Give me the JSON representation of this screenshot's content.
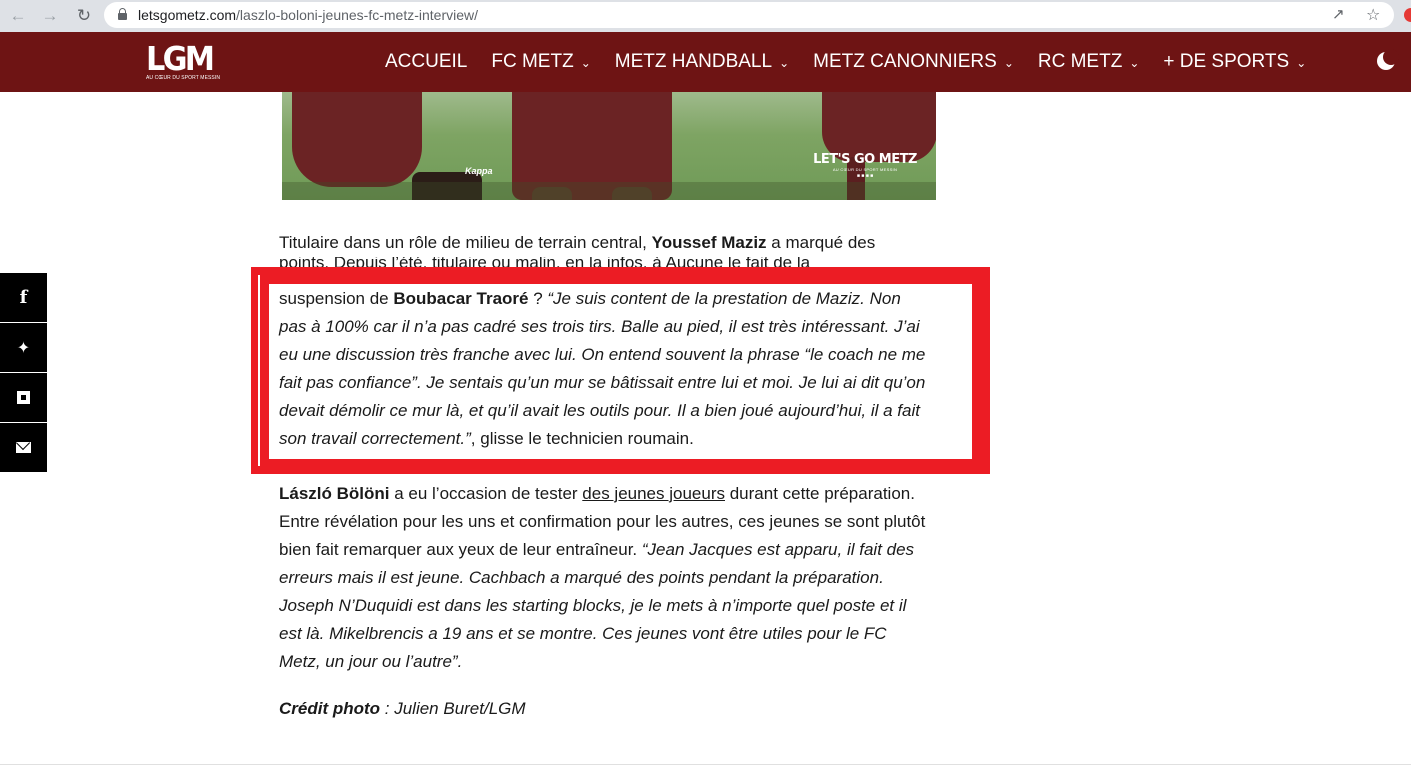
{
  "browser": {
    "url_host": "letsgometz.com",
    "url_path": "/laszlo-boloni-jeunes-fc-metz-interview/"
  },
  "site": {
    "logo": "LGM",
    "logo_tagline": "AU CŒUR DU SPORT MESSIN",
    "nav": [
      {
        "label": "ACCUEIL",
        "dropdown": false
      },
      {
        "label": "FC METZ",
        "dropdown": true
      },
      {
        "label": "METZ HANDBALL",
        "dropdown": true
      },
      {
        "label": "METZ CANONNIERS",
        "dropdown": true
      },
      {
        "label": "RC METZ",
        "dropdown": true
      },
      {
        "label": "+ DE SPORTS",
        "dropdown": true
      }
    ]
  },
  "hero": {
    "kit_brand": "Kappa",
    "watermark_title": "LET'S GO METZ",
    "watermark_sub": "AU CŒUR DU SPORT MESSIN"
  },
  "share": [
    "facebook-icon",
    "twitter-icon",
    "flipboard-icon",
    "mail-icon"
  ],
  "article": {
    "p1_start": "Titulaire dans un rôle de milieu de terrain central, ",
    "p1_name": "Youssef Maziz",
    "p1_end": " a marqué des",
    "p1_cut": "points. Depuis l’été, titulaire ou malin, en la infos, à Aucune le fait de la",
    "hl_start": "suspension de ",
    "hl_name": "Boubacar Traoré",
    "hl_mid": " ? ",
    "hl_quote": "“Je suis content de la prestation de Maziz. Non pas à 100% car il n’a pas cadré ses trois tirs. Balle au pied, il est très intéressant. J’ai eu une discussion très franche avec lui. On entend souvent la phrase “le coach ne me fait pas confiance”. Je sentais qu’un mur se bâtissait entre lui et moi. Je lui ai dit qu’on devait démolir ce mur là, et qu’il avait les outils pour. Il a bien joué aujourd’hui, il a fait son travail correctement.”",
    "hl_end": ", glisse le technicien roumain.",
    "p3_name": "László Bölöni",
    "p3_a": " a eu l’occasion de tester ",
    "p3_link": "des jeunes joueurs",
    "p3_b": " durant cette préparation. Entre révélation pour les uns et confirmation pour les autres, ces jeunes se sont plutôt bien fait remarquer aux yeux de leur entraîneur. ",
    "p3_quote": "“Jean Jacques est apparu, il fait des erreurs mais il est jeune. Cachbach a marqué des points pendant la préparation. Joseph N’Duquidi est dans les starting blocks, je le mets à n’importe quel poste et il est là. Mikelbrencis a 19 ans et se montre. Ces jeunes vont être utiles pour le FC Metz, un jour ou l’autre”.",
    "credit_label": "Crédit photo",
    "credit_value": " : Julien Buret/LGM"
  },
  "colors": {
    "header_bg": "#6e1414",
    "highlight_border": "#ec1c24"
  }
}
